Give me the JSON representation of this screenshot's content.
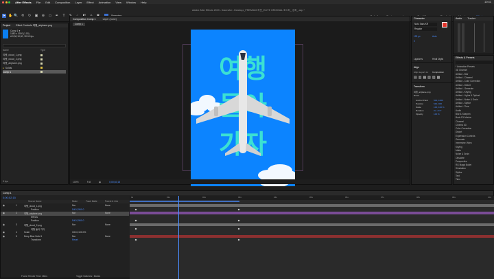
{
  "menubar": {
    "app": "After Effects",
    "items": [
      "File",
      "Edit",
      "Composition",
      "Layer",
      "Effect",
      "Animation",
      "View",
      "Window",
      "Help"
    ],
    "clock": "10:41"
  },
  "window_title": "Adobe After Effects 2023 - /Users/kr/...Desktop/_PREMIUM 하단_ELITE ORIGINAL 포스터_ 강좌_.aep *",
  "toolbar": {
    "snapping_label": "Snapping",
    "workspaces": [
      "Default",
      "Review",
      "Learn",
      "Small Screen",
      "Standard",
      "Libraries",
      "Effects"
    ],
    "active_workspace": "Effects"
  },
  "project": {
    "tab": "Project",
    "effect_controls_tab": "Effect Controls 여행_airplane.png",
    "comp_info": [
      "Comp 1 ▾",
      "1080 x 1920 (1.00)",
      "Δ 0;00;10;00, 30.00 fps"
    ],
    "items": [
      {
        "name": "여행_cloud_1.png",
        "color": "#d6d6b0"
      },
      {
        "name": "여행_cloud_2.png",
        "color": "#d6d6b0"
      },
      {
        "name": "여행_airplane.png",
        "color": "#d6d6b0"
      },
      {
        "name": "Solids",
        "color": "#e0c040"
      },
      {
        "name": "Comp 1",
        "color": "#d6d6b0"
      }
    ],
    "footer": "8 bpc"
  },
  "viewer": {
    "tabs": [
      "Composition Comp 1",
      "Layer (none)"
    ],
    "comp_chip": "Comp 1",
    "footer": [
      "100%",
      "Full",
      "0;00;02;15"
    ]
  },
  "poster": {
    "hangul": [
      "여행",
      "돌아",
      "가자"
    ]
  },
  "character": {
    "tab": "Character",
    "font": "Noto Sans KR",
    "style": "Regular",
    "size": "125 px",
    "tracking": "0",
    "leading": "Auto",
    "labels": {
      "ligatures": "Ligatures",
      "hindi": "Hindi Digits"
    },
    "align_tab": "Align",
    "align_label": "Align Layers to:",
    "align_target": "Composition",
    "tx_tab": "Transform",
    "tx_layer": "여행_airplane.png",
    "tx_rows": [
      "Anchor Point",
      "Position",
      "Scale",
      "Rotation",
      "Opacity"
    ],
    "tx_vals": [
      "500, 1000",
      "540, 960",
      "100, 100 %",
      "0x +0.0°",
      "100 %"
    ],
    "reset": "Reset"
  },
  "audio": {
    "tabs": [
      "Audio",
      "Tracker"
    ]
  },
  "effects": {
    "tab": "Effects & Presets",
    "items": [
      "* Animation Presets",
      "3D Channel",
      "Artifact - Blur",
      "Artifact - Channel",
      "Artifact - Color Correction",
      "Artifact - Distort",
      "Artifact - Generate",
      "Artifact - Keying",
      "Artifact - Lights & Optical",
      "Artifact - Noise & Grain",
      "Artifact - Stylize",
      "Artifact - Time",
      "Audio",
      "Blur & Sharpen",
      "Boris FX Mocha",
      "Channel",
      "Cinema 4D",
      "Color Correction",
      "Distort",
      "Expression Controls",
      "Generate",
      "Immersive Video",
      "Keying",
      "Matte",
      "Noise & Grain",
      "Obsolete",
      "Perspective",
      "RG Magic Bullet",
      "Simulation",
      "Stylize",
      "Text",
      "Time"
    ]
  },
  "timeline": {
    "tab": "Comp 1",
    "timecode": "0;00;02;15",
    "headers": {
      "name": "Source Name",
      "mode": "Mode",
      "trkmat": "Track Matte",
      "parent": "Parent & Link"
    },
    "layers": [
      {
        "n": "1",
        "name": "여행_cloud_1.png",
        "mode": "Nor",
        "parent": "None",
        "sel": false
      },
      {
        "n": "",
        "name": "Position",
        "mode": "540.0,960.0",
        "parent": "",
        "sel": false
      },
      {
        "n": "2",
        "name": "여행_airplane.png",
        "mode": "Nor",
        "parent": "None",
        "sel": true
      },
      {
        "n": "",
        "name": "Effects",
        "mode": "",
        "parent": "",
        "sel": false
      },
      {
        "n": "",
        "name": "Position",
        "mode": "540.0,960.0",
        "parent": "",
        "sel": false
      },
      {
        "n": "3",
        "name": "여행_cloud_2.png",
        "mode": "Nor",
        "parent": "None",
        "sel": false
      },
      {
        "n": "",
        "name": "여행 돌아 가자",
        "mode": "",
        "parent": "",
        "sel": false
      },
      {
        "n": "4",
        "name": "Scale",
        "mode": "100.0,100.0%",
        "parent": "",
        "sel": false
      },
      {
        "n": "5",
        "name": "Deep Blue Solid 1",
        "mode": "Nor",
        "parent": "None",
        "sel": false
      },
      {
        "n": "",
        "name": "Transform",
        "mode": "Reset",
        "parent": "",
        "sel": false
      }
    ],
    "ruler": [
      "0s",
      "01s",
      "02s",
      "03s",
      "04s",
      "05s",
      "06s",
      "07s",
      "08s",
      "09s",
      "10s"
    ],
    "footer": {
      "render": "Frame Render Time: 28ms",
      "toggle": "Toggle Switches / Modes"
    }
  },
  "colors": {
    "accent": "#4a8cff",
    "poster_bg": "#0c84ff",
    "hangul": "#3be0d3",
    "bar_gray": "#6b6b6b",
    "bar_purple": "#7a4c96",
    "bar_red": "#8c3030"
  }
}
